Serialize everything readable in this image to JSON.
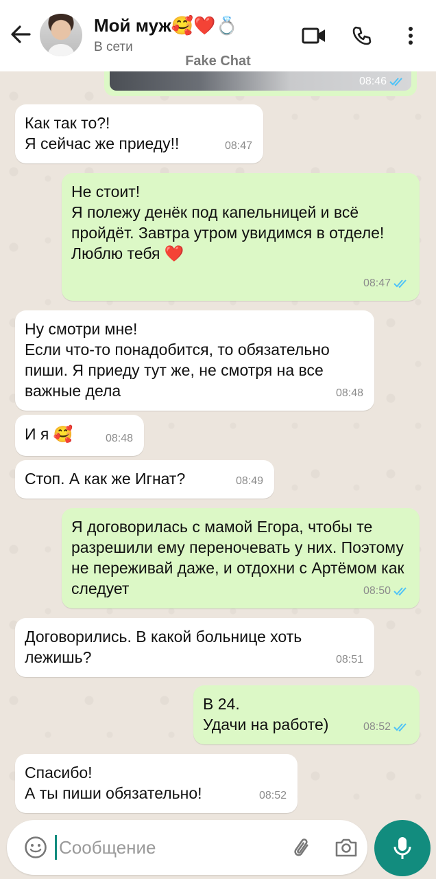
{
  "header": {
    "contact_name": "Мой муж🥰❤️💍",
    "status": "В сети",
    "watermark": "Fake Chat"
  },
  "partial_message": {
    "time": "08:46"
  },
  "messages": [
    {
      "dir": "in",
      "text": "Как так то?!\nЯ сейчас же приеду!!",
      "time": "08:47"
    },
    {
      "dir": "out",
      "text": "Не стоит!\nЯ полежу денёк под капельницей и всё пройдёт. Завтра утром увидимся в отделе!\nЛюблю тебя ❤️",
      "time": "08:47"
    },
    {
      "dir": "in",
      "text": "Ну смотри мне!\nЕсли что-то понадобится, то обязательно пиши. Я приеду тут же, не смотря на все важные дела",
      "time": "08:48"
    },
    {
      "dir": "in",
      "text": "И я 🥰",
      "time": "08:48"
    },
    {
      "dir": "in",
      "text": "Стоп. А как же Игнат?",
      "time": "08:49"
    },
    {
      "dir": "out",
      "text": "Я договорилась с мамой Егора, чтобы те разрешили ему переночевать у них. Поэтому не переживай даже, и отдохни с Артёмом как следует",
      "time": "08:50"
    },
    {
      "dir": "in",
      "text": "Договорились. В какой больнице хоть лежишь?",
      "time": "08:51"
    },
    {
      "dir": "out",
      "text": "В 24.\nУдачи на работе)",
      "time": "08:52"
    },
    {
      "dir": "in",
      "text": "Спасибо!\n А ты пиши обязательно!",
      "time": "08:52"
    }
  ],
  "input": {
    "placeholder": "Сообщение"
  },
  "colors": {
    "accent": "#128c7e",
    "outgoing": "#dcf8c6",
    "incoming": "#ffffff",
    "tick": "#4fc3f7"
  }
}
